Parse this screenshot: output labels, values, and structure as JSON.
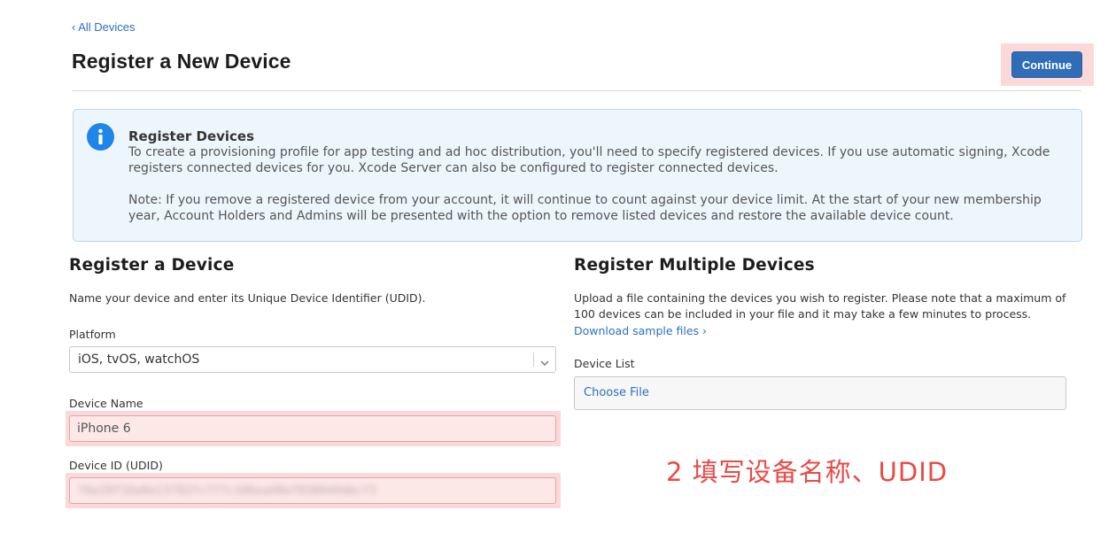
{
  "header": {
    "back_link": "‹ All Devices",
    "title": "Register a New Device",
    "continue_label": "Continue"
  },
  "info": {
    "icon": "info-icon",
    "title": "Register Devices",
    "paragraph1": "To create a provisioning profile for app testing and ad hoc distribution, you'll need to specify registered devices. If you use automatic signing, Xcode registers connected devices for you. Xcode Server can also be configured to register connected devices.",
    "paragraph2": "Note: If you remove a registered device from your account, it will continue to count against your device limit. At the start of your new membership year, Account Holders and Admins will be presented with the option to remove listed devices and restore the available device count."
  },
  "register_device": {
    "title": "Register a Device",
    "description": "Name your device and enter its Unique Device Identifier (UDID).",
    "platform_label": "Platform",
    "platform_value": "iOS, tvOS, watchOS",
    "device_name_label": "Device Name",
    "device_name_value": "iPhone 6",
    "udid_label": "Device ID (UDID)",
    "udid_value": "f6e20f16e0e13782fc777c106ea48ef838049dbcf3"
  },
  "register_multiple": {
    "title": "Register Multiple Devices",
    "description": "Upload a file containing the devices you wish to register. Please note that a maximum of 100 devices can be included in your file and it may take a few minutes to process.",
    "download_link": "Download sample files ›",
    "device_list_label": "Device List",
    "choose_file_label": "Choose File"
  },
  "annotation": {
    "text": "2 填写设备名称、UDID"
  },
  "colors": {
    "accent_blue": "#2f6db8",
    "link_blue": "#2b6fc2",
    "highlight_pink": "#fbd9d9",
    "annotation_red": "#ea4a44",
    "info_background": "#eef6fd",
    "info_icon_blue": "#1e86e8"
  }
}
